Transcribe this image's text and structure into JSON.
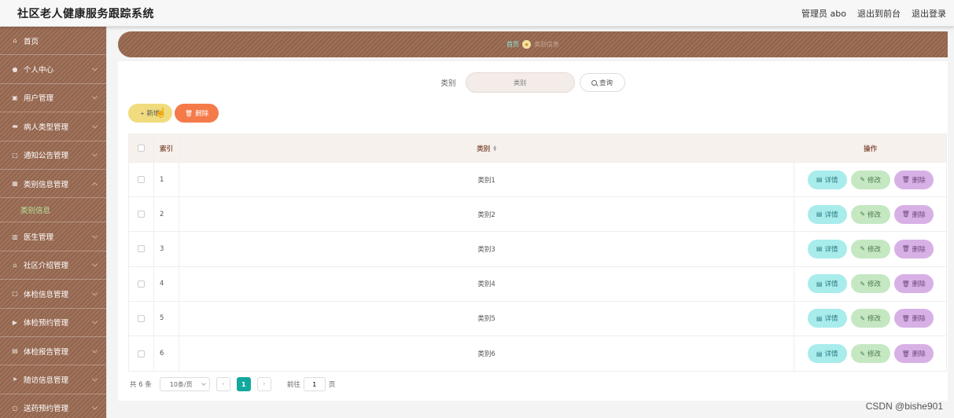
{
  "header": {
    "title": "社区老人健康服务跟踪系统",
    "admin_label": "管理员 abo",
    "front_link": "退出到前台",
    "logout_link": "退出登录"
  },
  "sidebar": {
    "items": [
      {
        "label": "首页",
        "icon": "home-icon",
        "glyph": "⌂"
      },
      {
        "label": "个人中心",
        "icon": "user-icon",
        "glyph": "●"
      },
      {
        "label": "用户管理",
        "icon": "users-icon",
        "glyph": "▣"
      },
      {
        "label": "病人类型管理",
        "icon": "list-icon",
        "glyph": "▬"
      },
      {
        "label": "通知公告管理",
        "icon": "frame-icon",
        "glyph": "□"
      },
      {
        "label": "类别信息管理",
        "icon": "grid-icon",
        "glyph": "▦"
      },
      {
        "label": "医生管理",
        "icon": "chart-icon",
        "glyph": "▥"
      },
      {
        "label": "社区介绍管理",
        "icon": "building-icon",
        "glyph": "⌂"
      },
      {
        "label": "体检信息管理",
        "icon": "crop-icon",
        "glyph": "□"
      },
      {
        "label": "体检预约管理",
        "icon": "flag-icon",
        "glyph": "▶"
      },
      {
        "label": "体检报告管理",
        "icon": "document-icon",
        "glyph": "▤"
      },
      {
        "label": "随访信息管理",
        "icon": "send-icon",
        "glyph": "➤"
      },
      {
        "label": "送药预约管理",
        "icon": "circle-icon",
        "glyph": "○"
      }
    ],
    "sub_item": "类别信息"
  },
  "breadcrumb": {
    "home": "首页",
    "current": "类别信息"
  },
  "search": {
    "label": "类别",
    "placeholder": "类别",
    "button": "查询"
  },
  "actions": {
    "add": "新增",
    "delete": "删除"
  },
  "table": {
    "headers": {
      "index": "索引",
      "category": "类别",
      "ops": "操作"
    },
    "rows": [
      {
        "index": "1",
        "category": "类别1"
      },
      {
        "index": "2",
        "category": "类别2"
      },
      {
        "index": "3",
        "category": "类别3"
      },
      {
        "index": "4",
        "category": "类别4"
      },
      {
        "index": "5",
        "category": "类别5"
      },
      {
        "index": "6",
        "category": "类别6"
      }
    ],
    "op_detail": "详情",
    "op_edit": "修改",
    "op_delete": "删除"
  },
  "pager": {
    "total": "共 6 条",
    "page_size": "10条/页",
    "current_page": "1",
    "goto_label": "前往",
    "goto_value": "1",
    "page_unit": "页"
  },
  "watermark": "CSDN @bishe901",
  "colors": {
    "sidebar": "#9a6a52",
    "accent": "#13a89e",
    "add_button": "#f0dc7e",
    "delete_button": "#f57a4a"
  }
}
